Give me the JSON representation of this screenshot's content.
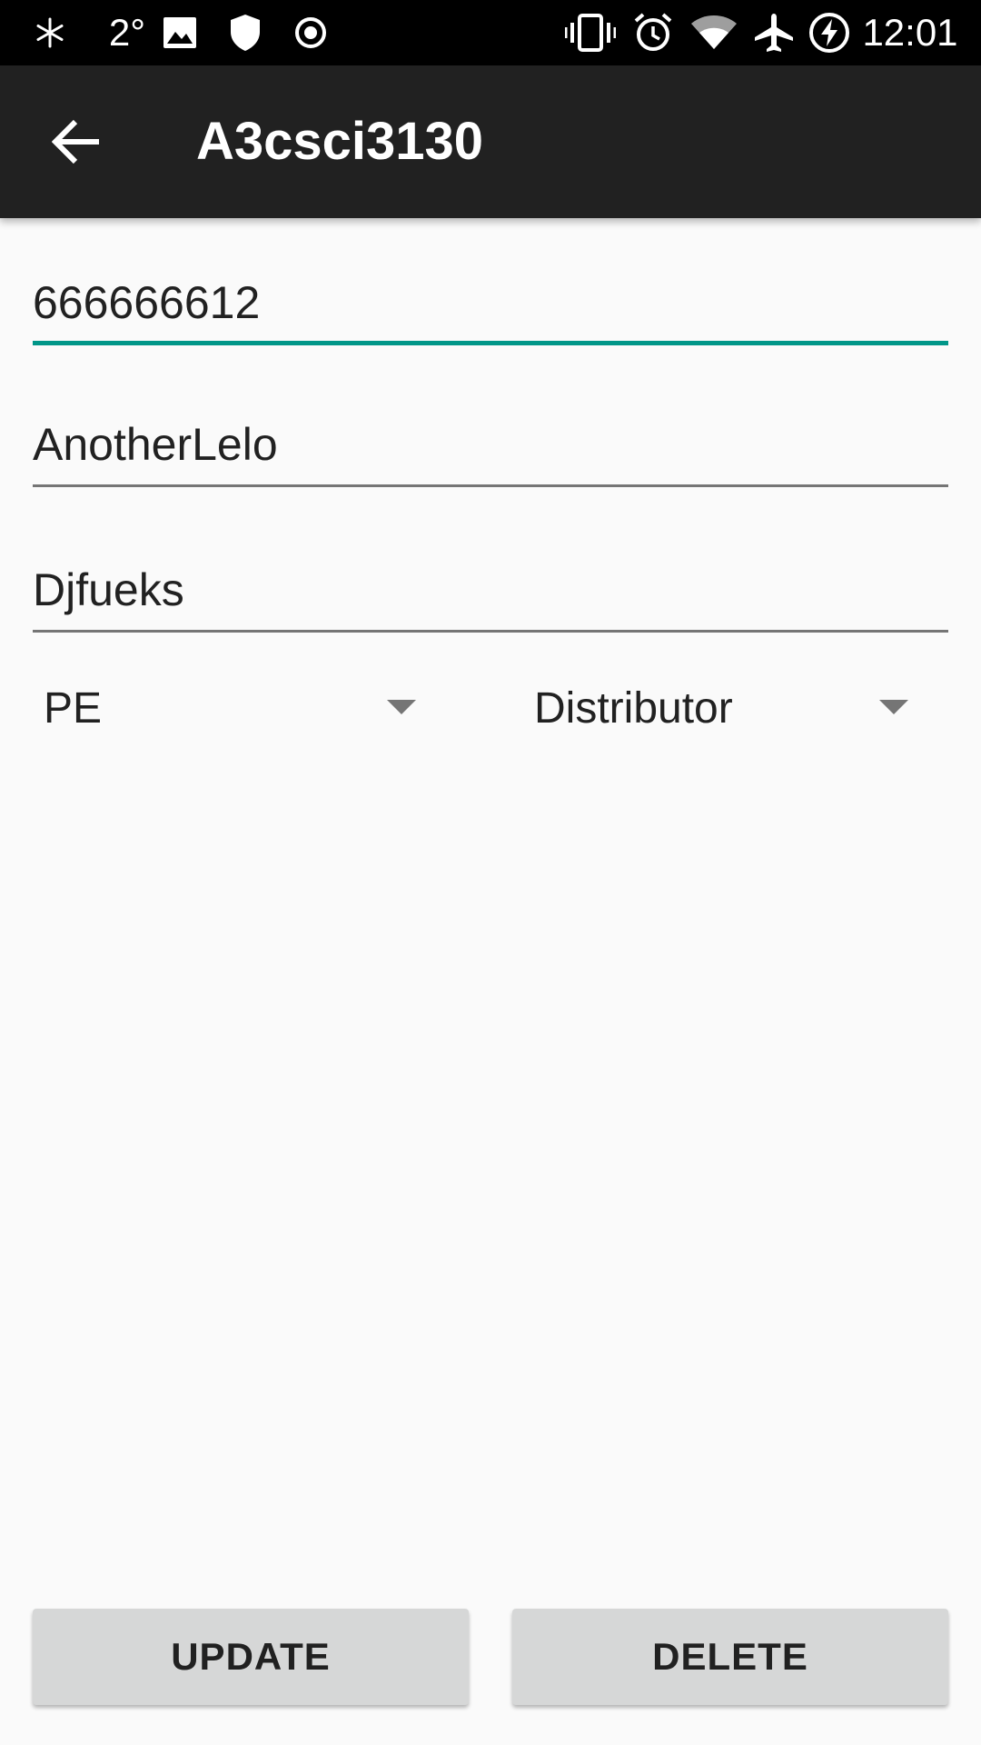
{
  "status_bar": {
    "temperature": "2°",
    "time": "12:01",
    "icons": [
      "snowflake-icon",
      "image-icon",
      "shield-icon",
      "record-icon",
      "vibrate-icon",
      "alarm-icon",
      "wifi-icon",
      "airplane-icon",
      "battery-charging-icon"
    ]
  },
  "app_bar": {
    "title": "A3csci3130",
    "background": "#212121"
  },
  "form": {
    "field_1_value": "666666612",
    "field_2_value": "AnotherLelo",
    "field_3_value": "Djfueks",
    "spinner_province": "PE",
    "spinner_type": "Distributor",
    "accent_color": "#009688"
  },
  "buttons": {
    "update_label": "UPDATE",
    "delete_label": "DELETE"
  }
}
